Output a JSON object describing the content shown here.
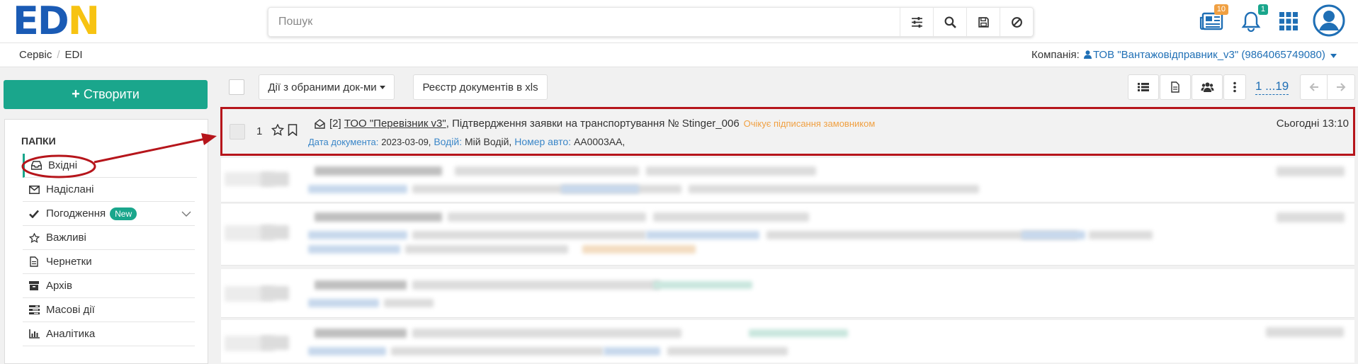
{
  "header": {
    "logo": {
      "e": "E",
      "d": "D",
      "n": "N"
    },
    "search": {
      "placeholder": "Пошук"
    },
    "icons": [
      "sliders-icon",
      "search-icon",
      "save-icon",
      "ban-icon"
    ],
    "news_badge": "10",
    "notifications_badge": "1"
  },
  "breadcrumb": {
    "items": [
      "Сервіс",
      "EDI"
    ]
  },
  "company": {
    "label": "Компанія:",
    "value": "ТОВ \"Вантажовідправник_v3\" (9864065749080)"
  },
  "sidebar": {
    "create_label": "Створити",
    "folders_title": "ПАПКИ",
    "items": [
      {
        "label": "Вхідні",
        "icon": "inbox-icon",
        "active": true
      },
      {
        "label": "Надіслані",
        "icon": "envelope-icon"
      },
      {
        "label": "Погодження",
        "icon": "check-icon",
        "badge": "New"
      },
      {
        "label": "Важливі",
        "icon": "star-icon"
      },
      {
        "label": "Чернетки",
        "icon": "file-icon"
      },
      {
        "label": "Архів",
        "icon": "archive-icon"
      },
      {
        "label": "Масові дії",
        "icon": "tasks-icon"
      },
      {
        "label": "Аналітика",
        "icon": "bar-chart-icon"
      }
    ]
  },
  "toolbar": {
    "bulk_actions_label": "Дії з обраними док-ми",
    "registry_label": "Реєстр документів в xls",
    "pager_label": "1 ...19"
  },
  "documents": [
    {
      "index": "1",
      "count": "[2]",
      "org": "ТОО \"Перевізник v3\"",
      "title": ", Підтвердження заявки на транспортування № Stinger_006",
      "status": "Очікує підписання замовником",
      "date_label": "Дата документа:",
      "date_value": "2023-03-09,",
      "driver_label": "Водій:",
      "driver_value": "Мій Водій,",
      "plate_label": "Номер авто:",
      "plate_value": "AA0003AA,",
      "time": "Сьогодні 13:10"
    }
  ],
  "colors": {
    "accent": "#1aa68c",
    "link": "#1f6fb5",
    "status": "#f0a042",
    "highlight": "#b6151b"
  }
}
